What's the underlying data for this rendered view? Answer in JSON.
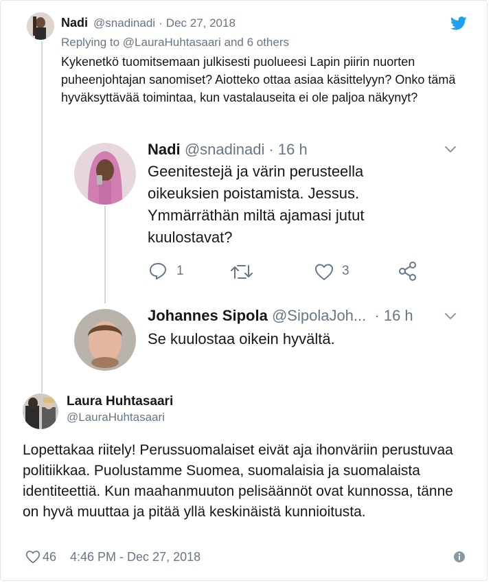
{
  "tweet1": {
    "name": "Nadi",
    "handle": "@snadinadi",
    "sep": "·",
    "date": "Dec 27, 2018",
    "replying_prefix": "Replying to",
    "replying_user": "@LauraHuhtasaari",
    "replying_suffix": "and 6 others",
    "text": "Kykenetkö tuomitsemaan julkisesti puolueesi Lapin piirin nuorten puheenjohtajan sanomiset? Aiotteko ottaa asiaa käsittelyyn? Onko tämä hyväksyttävää toimintaa, kun vastalauseita ei ole paljoa näkynyt?"
  },
  "tweet2": {
    "name": "Nadi",
    "handle": "@snadinadi",
    "sep": "·",
    "time": "16 h",
    "text": "Geenitestejä ja värin perusteella oikeuksien poistamista. Jessus. Ymmärräthän miltä ajamasi jutut kuulostavat?",
    "reply_count": "1",
    "like_count": "3"
  },
  "tweet3": {
    "name": "Johannes Sipola",
    "handle": "@SipolaJoh...",
    "sep": "·",
    "time": "16 h",
    "text": "Se kuulostaa oikein hyvältä."
  },
  "main": {
    "name": "Laura Huhtasaari",
    "handle": "@LauraHuhtasaari",
    "text": "Lopettakaa riitely! Perussuomalaiset eivät aja ihonväriin perustuvaa politiikkaa. Puolustamme Suomea, suomalaisia ja suomalaista identiteettiä. Kun maahanmuuton pelisäännöt ovat kunnossa, tänne on hyvä muuttaa ja pitää yllä keskinäistä kunnioitusta.",
    "like_count": "46",
    "timestamp": "4:46 PM - Dec 27, 2018"
  },
  "colors": {
    "twitter_blue": "#1da1f2",
    "muted_gray": "#657786",
    "text_dark": "#14171a",
    "line_gray": "#ccd6dd"
  },
  "icons": [
    "twitter-bird-icon",
    "chevron-down-icon",
    "reply-icon",
    "retweet-icon",
    "like-icon",
    "share-icon",
    "info-icon"
  ]
}
